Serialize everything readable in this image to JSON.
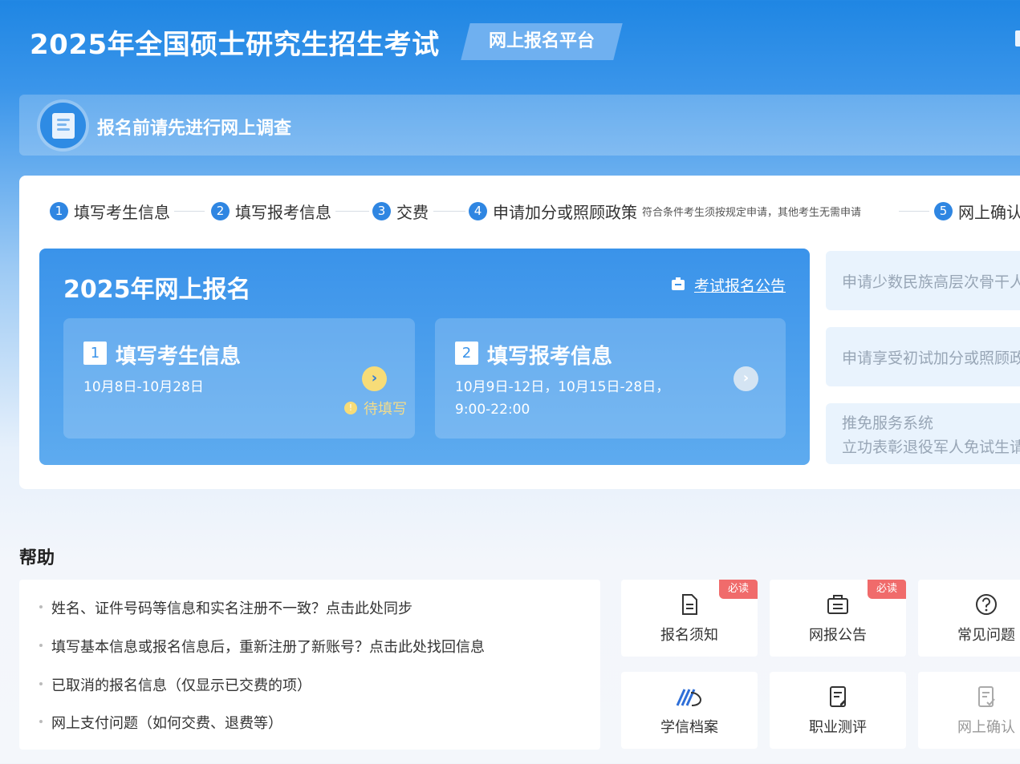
{
  "header": {
    "title": "2025年全国硕士研究生招生考试",
    "platform": "网上报名平台"
  },
  "survey": {
    "text": "报名前请先进行网上调查"
  },
  "steps": [
    {
      "num": "1",
      "label": "填写考生信息"
    },
    {
      "num": "2",
      "label": "填写报考信息"
    },
    {
      "num": "3",
      "label": "交费"
    },
    {
      "num": "4",
      "label": "申请加分或照顾政策",
      "note": "符合条件考生须按规定申请，其他考生无需申请"
    },
    {
      "num": "5",
      "label": "网上确认"
    }
  ],
  "registration": {
    "title": "2025年网上报名",
    "notice_link": "考试报名公告",
    "cards": [
      {
        "num": "1",
        "title": "填写考生信息",
        "date_line1": "10月8日-10月28日",
        "date_line2": "",
        "status": "待填写",
        "status_icon": "!"
      },
      {
        "num": "2",
        "title": "填写报考信息",
        "date_line1": "10月9日-12日，10月15日-28日，",
        "date_line2": "9:00-22:00"
      }
    ]
  },
  "side_links": [
    {
      "label": "申请少数民族高层次骨干人才计划"
    },
    {
      "label": "申请享受初试加分或照顾政策"
    },
    {
      "label": "推免服务系统",
      "sub": "立功表彰退役军人免试生请至此"
    }
  ],
  "help": {
    "title": "帮助",
    "items": [
      "姓名、证件号码等信息和实名注册不一致？点击此处同步",
      "填写基本信息或报名信息后，重新注册了新账号？点击此处找回信息",
      "已取消的报名信息（仅显示已交费的项）",
      "网上支付问题（如何交费、退费等）"
    ],
    "tiles": [
      {
        "label": "报名须知",
        "badge": "必读",
        "icon": "document-icon"
      },
      {
        "label": "网报公告",
        "badge": "必读",
        "icon": "announcement-icon"
      },
      {
        "label": "常见问题",
        "badge": "",
        "icon": "question-icon"
      },
      {
        "label": "学信档案",
        "badge": "",
        "icon": "chsi-logo-icon"
      },
      {
        "label": "职业测评",
        "badge": "",
        "icon": "assessment-icon"
      },
      {
        "label": "网上确认",
        "badge": "",
        "icon": "confirm-icon"
      }
    ]
  },
  "colors": {
    "primary": "#2f86e2",
    "badge": "#f06b6b",
    "pending": "#f7dc78"
  }
}
